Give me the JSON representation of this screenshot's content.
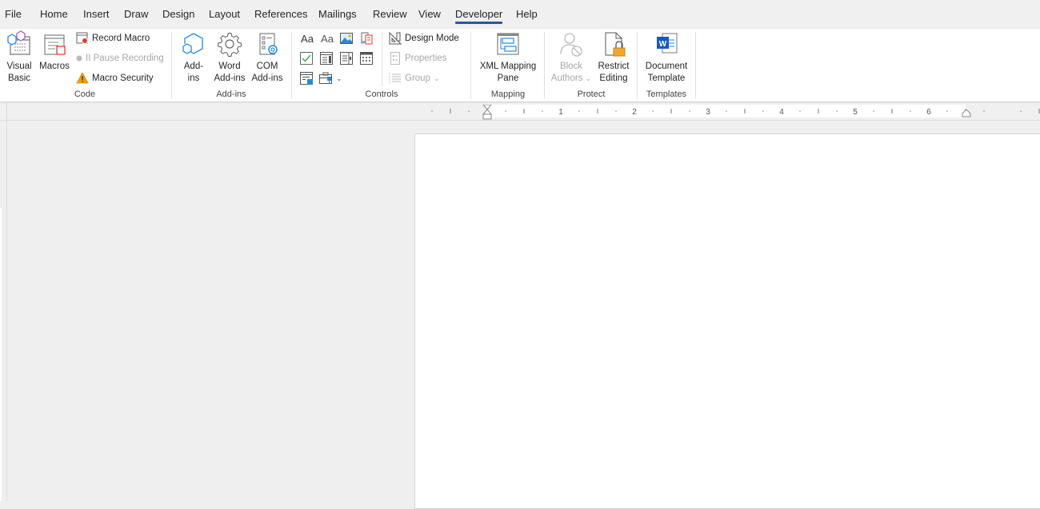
{
  "tabs": [
    {
      "label": "File"
    },
    {
      "label": "Home"
    },
    {
      "label": "Insert"
    },
    {
      "label": "Draw"
    },
    {
      "label": "Design"
    },
    {
      "label": "Layout"
    },
    {
      "label": "References"
    },
    {
      "label": "Mailings"
    },
    {
      "label": "Review"
    },
    {
      "label": "View"
    },
    {
      "label": "Developer",
      "active": true
    },
    {
      "label": "Help"
    }
  ],
  "ribbon": {
    "code": {
      "label": "Code",
      "visual_basic": [
        "Visual",
        "Basic"
      ],
      "macros": "Macros",
      "record_macro": "Record Macro",
      "pause_recording": "II Pause Recording",
      "macro_security": "Macro Security"
    },
    "addins": {
      "label": "Add-ins",
      "addins": [
        "Add-",
        "ins"
      ],
      "word_addins": [
        "Word",
        "Add-ins"
      ],
      "com_addins": [
        "COM",
        "Add-ins"
      ]
    },
    "controls": {
      "label": "Controls",
      "rich_text": "Aa",
      "plain_text": "Aa",
      "design_mode": "Design Mode",
      "properties": "Properties",
      "group": "Group"
    },
    "mapping": {
      "label": "Mapping",
      "xml_mapping": [
        "XML Mapping",
        "Pane"
      ]
    },
    "protect": {
      "label": "Protect",
      "block_authors": [
        "Block",
        "Authors"
      ],
      "restrict_editing": [
        "Restrict",
        "Editing"
      ]
    },
    "templates": {
      "label": "Templates",
      "document_template": [
        "Document",
        "Template"
      ]
    }
  },
  "ruler": {
    "numbers": [
      "1",
      "2",
      "3",
      "4",
      "5",
      "6"
    ]
  },
  "colors": {
    "accent": "#2b579a",
    "word_blue": "#185abd",
    "lock_orange": "#f0a830",
    "warning": "#f2a100",
    "record_red": "#e03c31"
  }
}
